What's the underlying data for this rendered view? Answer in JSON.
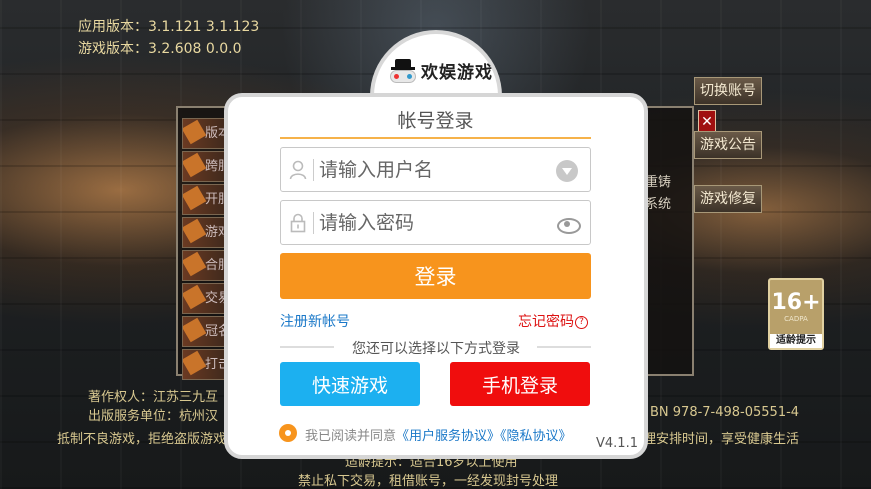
{
  "background": {
    "version_info": {
      "app_version": "应用版本：3.1.121  3.1.123",
      "game_version": "游戏版本：3.2.608  0.0.0"
    },
    "side_tabs": [
      "版本",
      "跨服",
      "开服",
      "游戏",
      "合服",
      "交易",
      "冠名",
      "打击"
    ],
    "panel_right_text": [
      "重铸",
      "系统"
    ],
    "right_buttons": {
      "switch_account": "切换账号",
      "announcement": "游戏公告",
      "repair": "游戏修复"
    },
    "close_symbol": "✕",
    "age_rating": {
      "number": "16+",
      "org": "CADPA",
      "tip": "适龄提示"
    },
    "footer": {
      "copyright": "著作权人：江苏三九互",
      "publisher": "出版服务单位：杭州汉",
      "isbn": "BN 978-7-498-05551-4",
      "health_left": "抵制不良游戏，拒绝盗版游戏",
      "health_right": "理安排时间，享受健康生活",
      "age_tip": "适龄提示：适合16岁以上使用",
      "no_trade": "禁止私下交易，租借账号，一经发现封号处理"
    }
  },
  "login": {
    "brand": "欢娱游戏",
    "title": "帐号登录",
    "username_placeholder": "请输入用户名",
    "password_placeholder": "请输入密码",
    "login_button": "登录",
    "register_link": "注册新帐号",
    "forgot_link": "忘记密码",
    "forgot_icon": "?",
    "alt_text": "您还可以选择以下方式登录",
    "quick_play_button": "快速游戏",
    "phone_login_button": "手机登录",
    "agree_prefix": "我已阅读并同意",
    "user_agreement": "《用户服务协议》",
    "privacy_agreement": "《隐私协议》",
    "version": "V4.1.1"
  }
}
